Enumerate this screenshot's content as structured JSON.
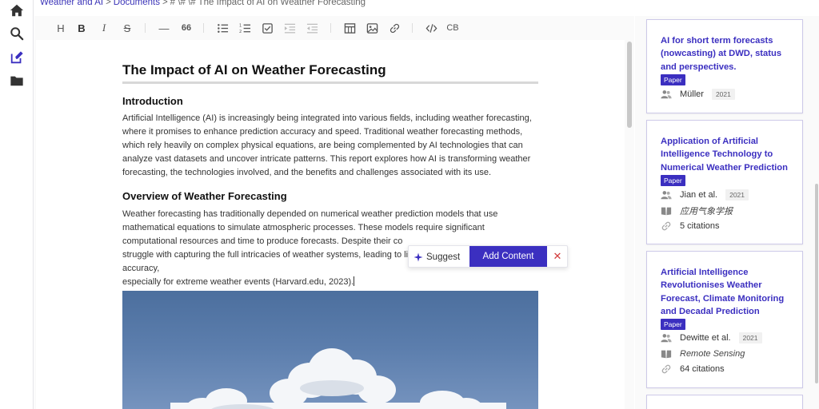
{
  "breadcrumb": {
    "items": [
      "Weather and AI",
      "Documents",
      "# \\# \\# The Impact of AI on Weather Forecasting"
    ],
    "separator": ">"
  },
  "sidebar": {
    "icons": [
      "home-icon",
      "search-icon",
      "edit-icon",
      "folder-icon"
    ]
  },
  "toolbar": {
    "heading": "H",
    "bold": "B",
    "italic": "I",
    "strike": "S",
    "hr": "—",
    "quote": "66",
    "code_block": "CB"
  },
  "document": {
    "title": "The Impact of AI on Weather Forecasting",
    "sections": [
      {
        "heading": "Introduction",
        "text": "Artificial Intelligence (AI) is increasingly being integrated into various fields, including weather forecasting, where it promises to enhance prediction accuracy and speed. Traditional weather forecasting methods, which rely heavily on complex physical equations, are being complemented by AI technologies that can analyze vast datasets and uncover intricate patterns. This report explores how AI is transforming weather forecasting, the technologies involved, and the benefits and challenges associated with its use."
      },
      {
        "heading": "Overview of Weather Forecasting",
        "text": "Weather forecasting has traditionally depended on numerical weather prediction models that use mathematical equations to simulate atmospheric processes. These models require significant computational resources and time to produce forecasts. Despite their co… struggle with capturing the full intricacies of weather systems, leading to limitations in prediction accuracy, especially for extreme weather events (Harvard.edu, 2023)."
      }
    ],
    "para2_lines": [
      "Weather forecasting has traditionally depended on numerical weather prediction models that use",
      "mathematical equations to simulate atmospheric processes. These models require significant",
      "computational resources and time to produce forecasts. Despite their co",
      "struggle with capturing the full intricacies of weather systems, leading to limitations in prediction accuracy,",
      "especially for extreme weather events (Harvard.edu, 2023)."
    ]
  },
  "ai_bar": {
    "suggest_label": "Suggest",
    "add_content_label": "Add Content",
    "close_label": "✕"
  },
  "references": [
    {
      "title": "AI for short term forecasts (nowcasting) at DWD, status and perspectives.",
      "badge": "Paper",
      "authors": "Müller",
      "year": "2021"
    },
    {
      "title": "Application of Artificial Intelligence Technology to Numerical Weather Prediction",
      "badge": "Paper",
      "authors": "Jian et al.",
      "year": "2021",
      "venue": "应用气象学报",
      "citations": "5 citations"
    },
    {
      "title": "Artificial Intelligence Revolutionises Weather Forecast, Climate Monitoring and Decadal Prediction",
      "badge": "Paper",
      "authors": "Dewitte et al.",
      "year": "2021",
      "venue": "Remote Sensing",
      "citations": "64 citations"
    }
  ],
  "colors": {
    "accent": "#3b2fc0",
    "link": "#3b34b8",
    "close": "#d23a3a"
  }
}
